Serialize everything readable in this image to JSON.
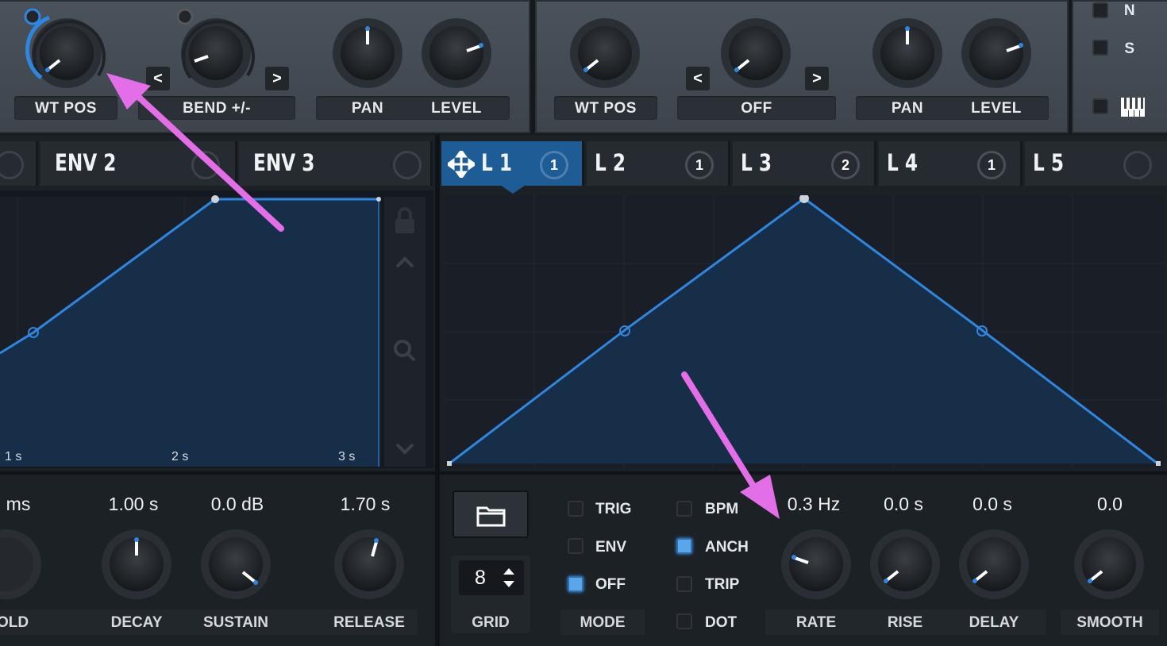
{
  "osc_a": {
    "wt_pos": "WT POS",
    "bend": "BEND +/-",
    "pan": "PAN",
    "level": "LEVEL",
    "prev": "<",
    "next": ">"
  },
  "osc_b": {
    "wt_pos": "WT POS",
    "mode": "OFF",
    "pan": "PAN",
    "level": "LEVEL",
    "prev": "<",
    "next": ">"
  },
  "side": {
    "n_label": "N",
    "s_label": "S"
  },
  "env_tabs": [
    {
      "label": "ENV 2"
    },
    {
      "label": "ENV 3"
    }
  ],
  "env_graph": {
    "time_labels": [
      "1 s",
      "2 s",
      "3 s"
    ]
  },
  "env_params": {
    "hold_value": "ms",
    "decay_value": "1.00 s",
    "sustain_value": "0.0 dB",
    "release_value": "1.70 s",
    "hold_label": "OLD",
    "decay_label": "DECAY",
    "sustain_label": "SUSTAIN",
    "release_label": "RELEASE"
  },
  "lfo_tabs": [
    {
      "label": "L 1",
      "count": "1"
    },
    {
      "label": "L 2",
      "count": "1"
    },
    {
      "label": "L 3",
      "count": "2"
    },
    {
      "label": "L 4",
      "count": "1"
    },
    {
      "label": "L 5",
      "count": ""
    }
  ],
  "lfo": {
    "grid_value": "8",
    "grid_label": "GRID",
    "mode_label": "MODE",
    "modes": [
      {
        "label": "TRIG",
        "checked": false
      },
      {
        "label": "ENV",
        "checked": false
      },
      {
        "label": "OFF",
        "checked": true
      }
    ],
    "options": [
      {
        "label": "BPM",
        "checked": false
      },
      {
        "label": "ANCH",
        "checked": true
      },
      {
        "label": "TRIP",
        "checked": false
      },
      {
        "label": "DOT",
        "checked": false
      }
    ],
    "rate_value": "0.3 Hz",
    "rise_value": "0.0 s",
    "delay_value": "0.0 s",
    "smooth_value": "0.0",
    "rate_label": "RATE",
    "rise_label": "RISE",
    "delay_label": "DELAY",
    "smooth_label": "SMOOTH"
  },
  "colors": {
    "accent": "#2f86e0",
    "annotation_arrow": "#e36ee8",
    "graph_fill": "#16304d"
  }
}
